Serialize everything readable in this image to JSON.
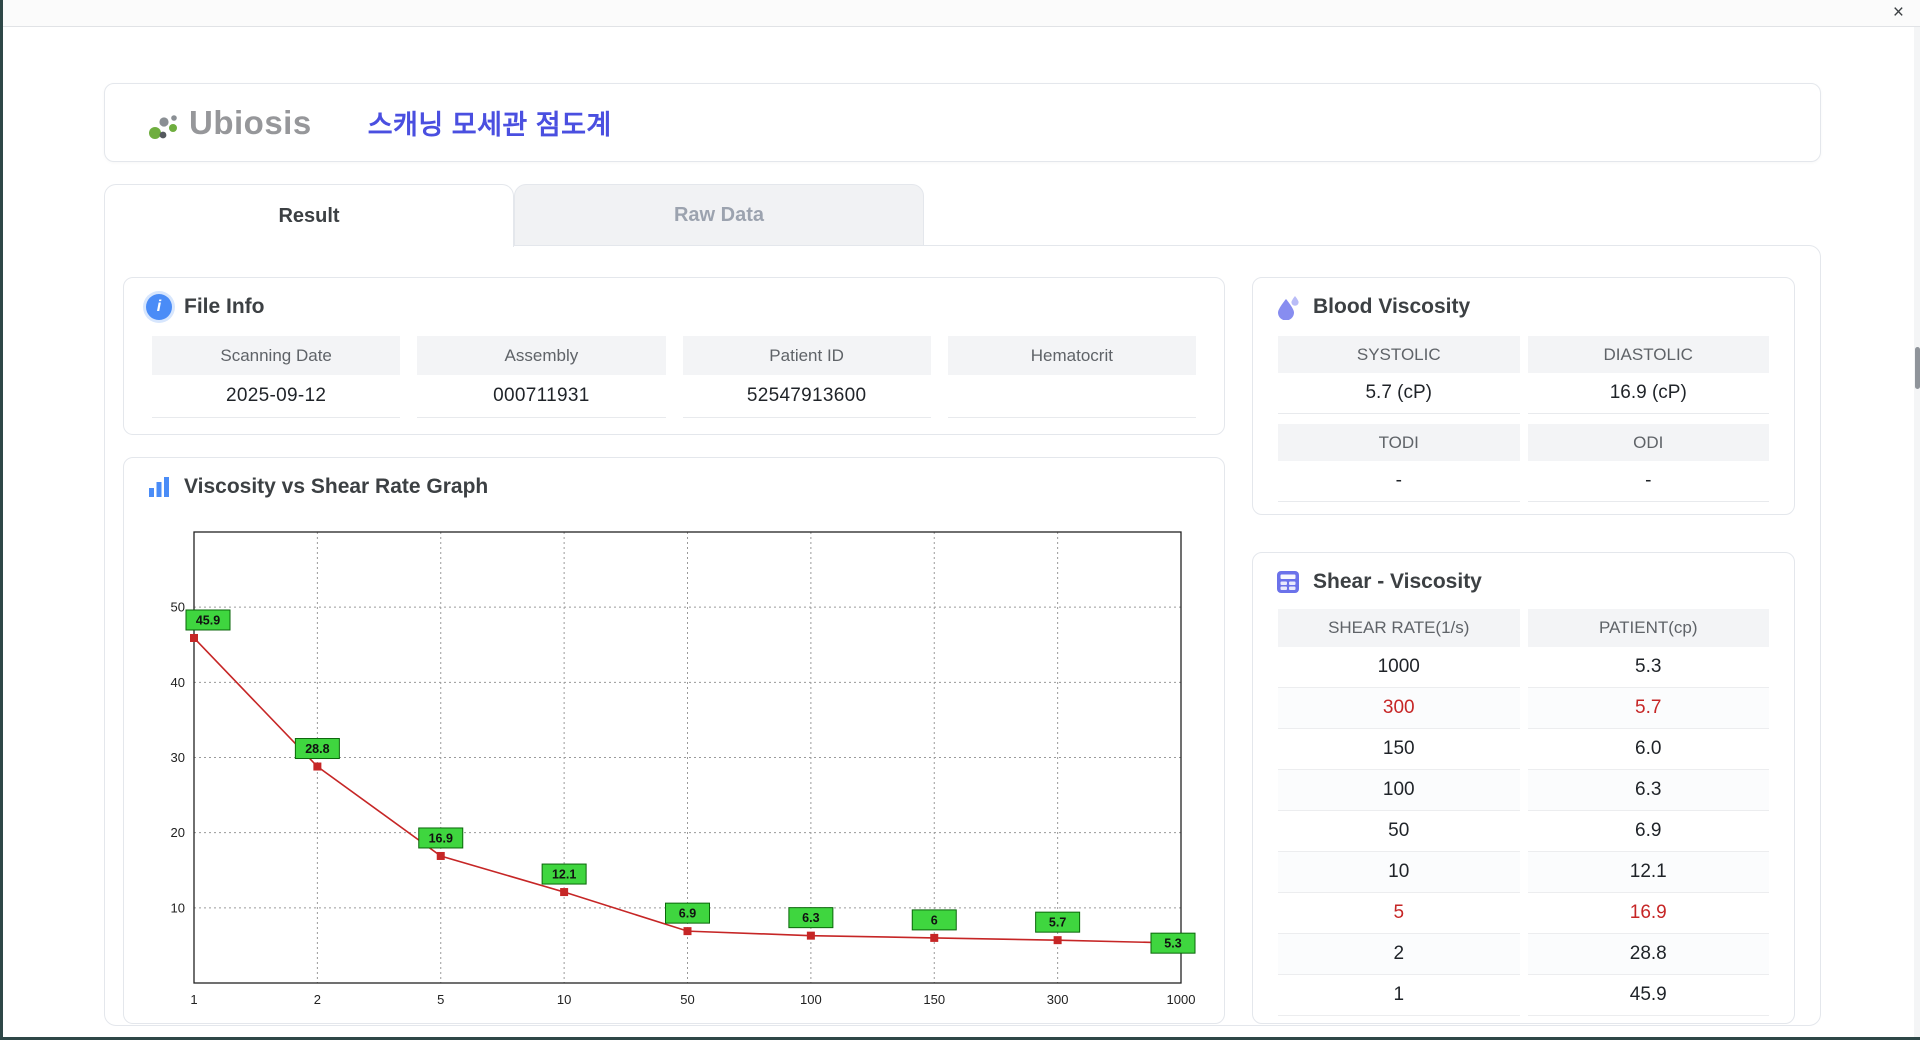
{
  "window": {
    "close_label": "×"
  },
  "header": {
    "logo_text": "Ubiosis",
    "title": "스캐닝 모세관 점도계"
  },
  "tabs": [
    {
      "label": "Result",
      "active": true
    },
    {
      "label": "Raw Data",
      "active": false
    }
  ],
  "file_info": {
    "title": "File Info",
    "fields": [
      {
        "label": "Scanning Date",
        "value": "2025-09-12"
      },
      {
        "label": "Assembly",
        "value": "000711931"
      },
      {
        "label": "Patient ID",
        "value": "52547913600"
      },
      {
        "label": "Hematocrit",
        "value": ""
      }
    ]
  },
  "graph": {
    "title": "Viscosity vs Shear Rate Graph"
  },
  "chart_data": {
    "type": "line",
    "title": "Viscosity vs Shear Rate Graph",
    "x": [
      1,
      2,
      5,
      10,
      50,
      100,
      150,
      300,
      1000
    ],
    "x_labels": [
      "1",
      "2",
      "5",
      "10",
      "50",
      "100",
      "150",
      "300",
      "1000"
    ],
    "values": [
      45.9,
      28.8,
      16.9,
      12.1,
      6.9,
      6.3,
      6,
      5.7,
      5.3
    ],
    "point_labels": [
      "45.9",
      "28.8",
      "16.9",
      "12.1",
      "6.9",
      "6.3",
      "6",
      "5.7",
      "5.3"
    ],
    "xlabel": "",
    "ylabel": "",
    "x_scale": "categorical",
    "ylim": [
      0,
      60
    ],
    "yticks": [
      10,
      20,
      30,
      40,
      50
    ],
    "grid": true,
    "line_color": "#c62626",
    "marker_color": "#c62626",
    "label_bg": "#3fd63f",
    "label_border": "#0a660a"
  },
  "blood_viscosity": {
    "title": "Blood Viscosity",
    "cells": [
      {
        "label": "SYSTOLIC",
        "value": "5.7 (cP)"
      },
      {
        "label": "DIASTOLIC",
        "value": "16.9 (cP)"
      },
      {
        "label": "TODI",
        "value": "-"
      },
      {
        "label": "ODI",
        "value": "-"
      }
    ]
  },
  "shear_viscosity": {
    "title": "Shear - Viscosity",
    "columns": [
      "SHEAR RATE(1/s)",
      "PATIENT(cp)"
    ],
    "rows": [
      {
        "shear": "1000",
        "patient": "5.3",
        "highlight": false
      },
      {
        "shear": "300",
        "patient": "5.7",
        "highlight": true
      },
      {
        "shear": "150",
        "patient": "6.0",
        "highlight": false
      },
      {
        "shear": "100",
        "patient": "6.3",
        "highlight": false
      },
      {
        "shear": "50",
        "patient": "6.9",
        "highlight": false
      },
      {
        "shear": "10",
        "patient": "12.1",
        "highlight": false
      },
      {
        "shear": "5",
        "patient": "16.9",
        "highlight": true
      },
      {
        "shear": "2",
        "patient": "28.8",
        "highlight": false
      },
      {
        "shear": "1",
        "patient": "45.9",
        "highlight": false
      }
    ]
  }
}
